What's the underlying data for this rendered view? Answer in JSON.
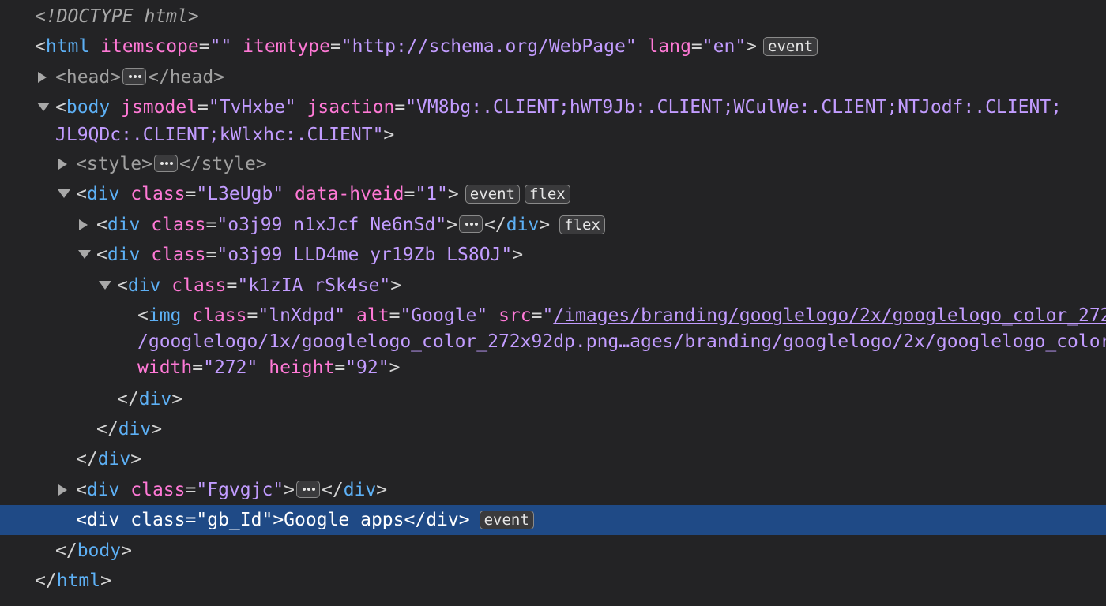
{
  "lines": {
    "doctype": "<!DOCTYPE html>",
    "html": {
      "tag": "html",
      "attr1": "itemscope",
      "val1": "\"\"",
      "attr2": "itemtype",
      "val2": "\"http://schema.org/WebPage\"",
      "attr3": "lang",
      "val3": "\"en\"",
      "badge": "event"
    },
    "head": {
      "open": "<head>",
      "close": "</head>"
    },
    "body": {
      "tag": "body",
      "attr1": "jsmodel",
      "val1": "\"TvHxbe\"",
      "attr2": "jsaction",
      "val2": "\"VM8bg:.CLIENT;hWT9Jb:.CLIENT;WCulWe:.CLIENT;NTJodf:.CLIENT;",
      "cont": "JL9QDc:.CLIENT;kWlxhc:.CLIENT\""
    },
    "style": {
      "open": "<style>",
      "close": "</style>"
    },
    "div_l3": {
      "tag": "div",
      "attr1": "class",
      "val1": "\"L3eUgb\"",
      "attr2": "data-hveid",
      "val2": "\"1\"",
      "badge1": "event",
      "badge2": "flex"
    },
    "div_o3j_1": {
      "tag": "div",
      "attr1": "class",
      "val1": "\"o3j99 n1xJcf Ne6nSd\"",
      "close_tag": "div",
      "badge": "flex"
    },
    "div_o3j_2": {
      "tag": "div",
      "attr1": "class",
      "val1": "\"o3j99 LLD4me yr19Zb LS8OJ\""
    },
    "div_k1z": {
      "tag": "div",
      "attr1": "class",
      "val1": "\"k1zIA rSk4se\""
    },
    "img": {
      "tag": "img",
      "attr1": "class",
      "val1": "\"lnXdpd\"",
      "attr2": "alt",
      "val2": "\"Google\"",
      "attr3": "src",
      "q": "\"",
      "link1": "/images/branding/googlelogo/2x/googlelogo_color_272x92dp.png",
      "link2": "/googlelogo/1x/googlelogo_color_272x92dp.png…ages/branding/googlelogo/2x/googlelogo_color_272x92dp.png",
      "attr4": "width",
      "val4": "\"272\"",
      "attr5": "height",
      "val5": "\"92\""
    },
    "close_div": "div",
    "div_fgv": {
      "tag": "div",
      "attr1": "class",
      "val1": "\"Fgvgjc\"",
      "close_tag": "div"
    },
    "div_gb": {
      "tag": "div",
      "attr1": "class",
      "val1": "\"gb_Id\"",
      "text": "Google apps",
      "close_tag": "div",
      "badge": "event"
    },
    "close_body": "body",
    "close_html": "html"
  }
}
